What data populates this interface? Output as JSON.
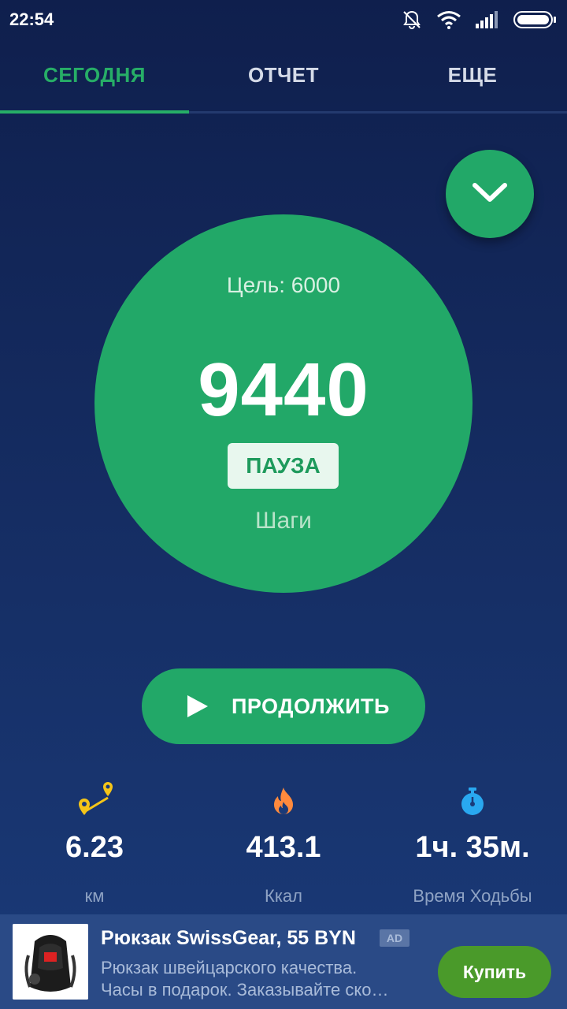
{
  "status_bar": {
    "time": "22:54",
    "icons": [
      "bell-off-icon",
      "wifi-icon",
      "signal-icon",
      "battery-icon"
    ]
  },
  "tabs": [
    {
      "label": "СЕГОДНЯ",
      "active": true
    },
    {
      "label": "ОТЧЕТ",
      "active": false
    },
    {
      "label": "ЕЩЕ",
      "active": false
    }
  ],
  "collapse_button": {
    "icon": "chevron-down-icon"
  },
  "steps": {
    "goal": "Цель: 6000",
    "value": "9440",
    "pause_label": "ПАУЗА",
    "unit": "Шаги"
  },
  "continue_button": {
    "icon": "play-icon",
    "label": "ПРОДОЛЖИТЬ"
  },
  "stats": [
    {
      "icon": "route-icon",
      "value": "6.23",
      "label": "км"
    },
    {
      "icon": "flame-icon",
      "value": "413.1",
      "label": "Ккал"
    },
    {
      "icon": "stopwatch-icon",
      "value": "1ч. 35м.",
      "label": "Время Ходьбы"
    }
  ],
  "ad": {
    "title": "Рюкзак SwissGear, 55 BYN",
    "badge": "AD",
    "description_line1": "Рюкзак швейцарского качества.",
    "description_line2": "Часы в подарок. Заказывайте ско…",
    "cta": "Купить"
  },
  "colors": {
    "accent_green": "#22a868",
    "tab_active": "#27ae67",
    "background_top": "#0f1f4d",
    "background_bottom": "#1a3a78",
    "route_icon": "#f5c518",
    "flame_icon": "#ff8a3d",
    "stopwatch_icon": "#29a8f0",
    "buy_button": "#4a9a2a"
  }
}
